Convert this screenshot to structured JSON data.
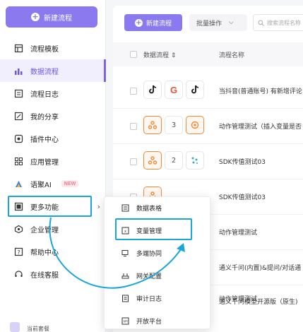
{
  "sidebar": {
    "new_flow": "新建流程",
    "items": [
      {
        "label": "流程模板",
        "icon": "template-icon"
      },
      {
        "label": "数据流程",
        "icon": "bar-chart-icon",
        "active": true
      },
      {
        "label": "流程日志",
        "icon": "log-icon"
      },
      {
        "label": "我的分享",
        "icon": "share-icon"
      },
      {
        "label": "插件中心",
        "icon": "plugin-icon"
      },
      {
        "label": "应用管理",
        "icon": "app-grid-icon"
      },
      {
        "label": "语聚AI",
        "icon": "ai-icon",
        "badge": "NEW"
      },
      {
        "label": "更多功能",
        "icon": "more-icon",
        "chevron": "›"
      },
      {
        "label": "企业管理",
        "icon": "enterprise-icon"
      },
      {
        "label": "帮助中心",
        "icon": "help-icon"
      },
      {
        "label": "在线客服",
        "icon": "headset-icon"
      }
    ],
    "plan_label": "当前套餐"
  },
  "toolbar": {
    "new_flow": "新建流程",
    "batch": "批量操作",
    "batch_arrow": "⌵",
    "search_placeholder": "搜索流程名称"
  },
  "table": {
    "col_flow": "数据流程 ⇕",
    "col_name": "流程名称",
    "rows": [
      {
        "tiles": [
          "tiktok-icon",
          "G",
          "tiktok-icon"
        ],
        "name": "当抖音(普通账号) 有新增评论"
      },
      {
        "tiles": [
          "webhook-icon",
          "3",
          "gear-hex-icon"
        ],
        "name": "动作管理测试（插入变量是否"
      },
      {
        "tiles": [
          "webhook-icon",
          "2",
          "dots-icon"
        ],
        "name": "SDK传值测试03"
      },
      {
        "tiles": [
          "webhook-icon",
          "",
          ""
        ],
        "name": "SDK传值测试03"
      },
      {
        "tiles": [],
        "name": "动作管理测试"
      },
      {
        "tiles": [],
        "name": "通义千问(内置)&提问/对话通"
      },
      {
        "tiles": [],
        "name": "动作管理测试"
      },
      {
        "tiles": [],
        "name": "通义千问模型开源版（原生)"
      }
    ]
  },
  "submenu": {
    "items": [
      {
        "label": "数据表格",
        "icon": "table-icon"
      },
      {
        "label": "变量管理",
        "icon": "variable-icon"
      },
      {
        "label": "多端协同",
        "icon": "devices-icon"
      },
      {
        "label": "网关配置",
        "icon": "gateway-icon"
      },
      {
        "label": "审计日志",
        "icon": "audit-icon"
      },
      {
        "label": "开放平台",
        "icon": "api-icon"
      }
    ]
  },
  "colors": {
    "accent": "#8b79ef",
    "highlight": "#1aa6d9",
    "orange": "#f08a3a"
  }
}
